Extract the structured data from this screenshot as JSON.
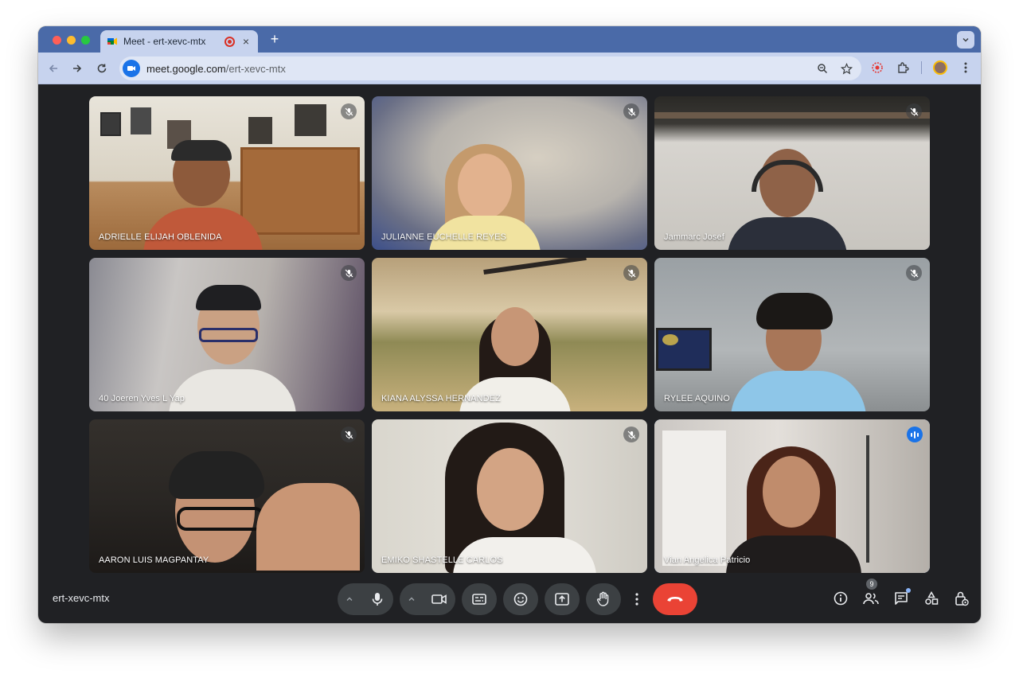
{
  "browser": {
    "tab": {
      "title": "Meet - ert-xevc-mtx",
      "close": "×"
    },
    "new_tab": "+",
    "address": {
      "host": "meet.google.com",
      "path": "/ert-xevc-mtx"
    }
  },
  "meeting": {
    "code": "ert-xevc-mtx"
  },
  "participants": [
    {
      "name": "ADRIELLE ELIJAH OBLENIDA",
      "muted": true
    },
    {
      "name": "JULIANNE EUCHELLE REYES",
      "muted": true
    },
    {
      "name": "Jammarc Josef",
      "muted": true
    },
    {
      "name": "40 Joeren Yves L Yap",
      "muted": true
    },
    {
      "name": "KIANA ALYSSA HERNANDEZ",
      "muted": true
    },
    {
      "name": "RYLEE AQUINO",
      "muted": true
    },
    {
      "name": "AARON LUIS MAGPANTAY",
      "muted": true
    },
    {
      "name": "EMIKO SHASTELLE CARLOS",
      "muted": true
    },
    {
      "name": "Vian Angelica Patricio",
      "muted": false,
      "speaking": true
    }
  ],
  "people_count": "9",
  "colors": {
    "hangup": "#ea4335",
    "speaking_border": "#8ab4f8",
    "control_bg": "#3c4043",
    "window_bg": "#202124"
  },
  "icons": {
    "controls": [
      "chevron-up-icon",
      "microphone-icon",
      "chevron-up-icon",
      "camera-icon",
      "captions-icon",
      "emoji-icon",
      "present-icon",
      "raise-hand-icon",
      "more-vert-icon",
      "hangup-icon"
    ],
    "right": [
      "info-icon",
      "people-icon",
      "chat-icon",
      "activities-icon",
      "host-controls-icon"
    ]
  }
}
